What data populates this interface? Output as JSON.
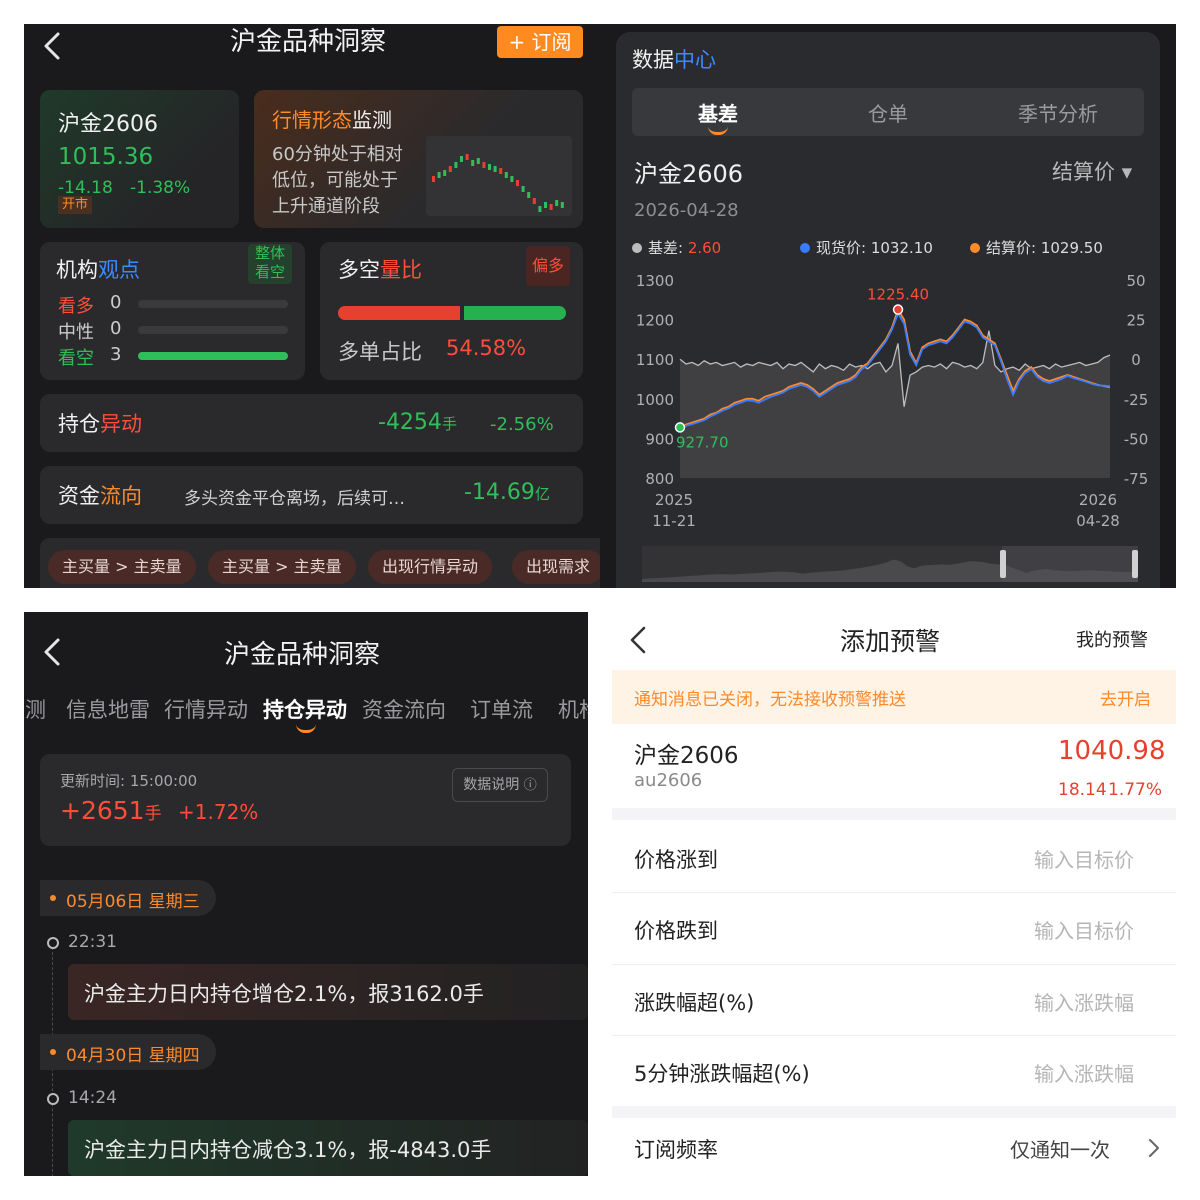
{
  "q1": {
    "header": {
      "title": "沪金品种洞察",
      "subscribe_label": "+ 订阅"
    },
    "price_card": {
      "name": "沪金2606",
      "price": "1015.36",
      "change": "-14.18",
      "change_pct": "-1.38%",
      "badge": "开市"
    },
    "trend_card": {
      "title_a": "行情形态",
      "title_b": "监测",
      "desc": [
        "60分钟处于相对",
        "低位，可能处于",
        "上升通道阶段"
      ]
    },
    "views_card": {
      "title_a": "机构",
      "title_b": "观点",
      "badge": [
        "整体",
        "看空"
      ],
      "rows": [
        {
          "label": "看多",
          "count": "0"
        },
        {
          "label": "中性",
          "count": "0"
        },
        {
          "label": "看空",
          "count": "3"
        }
      ]
    },
    "ratio_card": {
      "title_a": "多空",
      "title_b": "量比",
      "badge": "偏多",
      "label": "多单占比",
      "value": "54.58%",
      "long_fraction": 0.5458
    },
    "position_card": {
      "title_a": "持仓",
      "title_b": "异动",
      "value": "-4254",
      "unit": "手",
      "pct": "-2.56%"
    },
    "flow_card": {
      "title_a": "资金",
      "title_b": "流向",
      "desc": "多头资金平仓离场，后续可…",
      "value": "-14.69",
      "unit": "亿"
    },
    "pills": [
      "主买量 > 主卖量",
      "主买量 > 主卖量",
      "出现行情异动",
      "出现需求"
    ]
  },
  "q2": {
    "header": {
      "title_a": "数据",
      "title_b": "中心"
    },
    "tabs": [
      "基差",
      "仓单",
      "季节分析"
    ],
    "contract": "沪金2606",
    "date": "2026-04-28",
    "price_type": "结算价 ▾",
    "colors": {
      "basis": "#bdbdbd",
      "spot": "#3b7bff",
      "settle": "#ff8a2a"
    },
    "chart_data": {
      "type": "line",
      "legend": [
        {
          "label": "基差: ",
          "value": "2.60",
          "color": "#bdbdbd"
        },
        {
          "label": "现货价: ",
          "value": "1032.10",
          "color": "#3b7bff"
        },
        {
          "label": "结算价: ",
          "value": "1029.50",
          "color": "#ff8a2a"
        }
      ],
      "y_left": {
        "min": 800,
        "max": 1300,
        "ticks": [
          "1300",
          "1200",
          "1100",
          "1000",
          "900",
          "800"
        ]
      },
      "y_right": {
        "min": -75,
        "max": 50,
        "ticks": [
          "50",
          "25",
          "0",
          "-25",
          "-50",
          "-75"
        ]
      },
      "x_ticks": [
        {
          "top": "2025",
          "bottom": "11-21"
        },
        {
          "top": "2026",
          "bottom": "04-28"
        }
      ],
      "annotations": {
        "max": "1225.40",
        "min": "927.70"
      },
      "settle": [
        927.7,
        935,
        940,
        945,
        950,
        960,
        965,
        975,
        980,
        990,
        995,
        1000,
        1000,
        995,
        1005,
        1010,
        1015,
        1020,
        1030,
        1035,
        1040,
        1035,
        1025,
        1010,
        1020,
        1030,
        1040,
        1045,
        1050,
        1060,
        1080,
        1090,
        1110,
        1130,
        1150,
        1180,
        1225.4,
        1200,
        1120,
        1090,
        1130,
        1140,
        1145,
        1150,
        1145,
        1160,
        1180,
        1200,
        1195,
        1185,
        1160,
        1150,
        1140,
        1100,
        1060,
        1020,
        1050,
        1070,
        1080,
        1060,
        1050,
        1045,
        1050,
        1055,
        1060,
        1055,
        1050,
        1045,
        1040,
        1035,
        1032,
        1029.5
      ],
      "spot": [
        927.7,
        932,
        936,
        941,
        946,
        955,
        962,
        970,
        976,
        985,
        990,
        996,
        995,
        990,
        998,
        1005,
        1010,
        1016,
        1025,
        1030,
        1035,
        1030,
        1020,
        1005,
        1015,
        1025,
        1035,
        1040,
        1045,
        1055,
        1075,
        1085,
        1105,
        1125,
        1145,
        1175,
        1215,
        1190,
        1112,
        1085,
        1125,
        1135,
        1140,
        1145,
        1140,
        1155,
        1175,
        1195,
        1190,
        1180,
        1155,
        1145,
        1135,
        1095,
        1050,
        1010,
        1045,
        1065,
        1075,
        1055,
        1045,
        1040,
        1045,
        1050,
        1058,
        1052,
        1048,
        1043,
        1038,
        1034,
        1033,
        1032.1
      ],
      "basis": [
        0,
        -3,
        -2,
        -4,
        -1,
        -3,
        -2,
        -4,
        -3,
        -2,
        -5,
        -3,
        -4,
        -2,
        -3,
        -4,
        -2,
        -6,
        -3,
        -4,
        -2,
        -5,
        -8,
        -3,
        -6,
        -4,
        -5,
        -7,
        -3,
        -5,
        -4,
        -6,
        -3,
        -2,
        -8,
        -4,
        10,
        -30,
        -10,
        -8,
        -5,
        -4,
        -5,
        -3,
        -6,
        -2,
        -3,
        -5,
        -4,
        -6,
        -2,
        18,
        -4,
        -8,
        -6,
        -5,
        -7,
        -3,
        -6,
        -5,
        -4,
        -6,
        -3,
        -5,
        -4,
        -3,
        -2,
        -4,
        -3,
        -2,
        1,
        2.6
      ]
    }
  },
  "q3": {
    "header": {
      "title": "沪金品种洞察"
    },
    "tabs": [
      "监测",
      "信息地雷",
      "行情异动",
      "持仓异动",
      "资金流向",
      "订单流",
      "机构"
    ],
    "active_tab": 3,
    "summary": {
      "update_label": "更新时间: 15:00:00",
      "info_button": "数据说明",
      "value": "+2651",
      "unit": "手",
      "pct": "+1.72%"
    },
    "events": [
      {
        "date": "05月06日 星期三",
        "time": "22:31",
        "text": "沪金主力日内持仓增仓2.1%，报3162.0手"
      },
      {
        "date": "04月30日 星期四",
        "time": "14:24",
        "text": "沪金主力日内持仓减仓3.1%，报-4843.0手"
      }
    ]
  },
  "q4": {
    "header": {
      "title": "添加预警",
      "right": "我的预警"
    },
    "notice": {
      "text": "通知消息已关闭，无法接收预警推送",
      "action": "去开启"
    },
    "instrument": {
      "name": "沪金2606",
      "code": "au2606",
      "price": "1040.98",
      "change": "18.14",
      "change_pct": "1.77%"
    },
    "fields": [
      {
        "label": "价格涨到",
        "placeholder": "输入目标价"
      },
      {
        "label": "价格跌到",
        "placeholder": "输入目标价"
      },
      {
        "label": "涨跌幅超(%)",
        "placeholder": "输入涨跌幅"
      },
      {
        "label": "5分钟涨跌幅超(%)",
        "placeholder": "输入涨跌幅"
      }
    ],
    "frequency": {
      "label": "订阅频率",
      "value": "仅通知一次"
    }
  }
}
